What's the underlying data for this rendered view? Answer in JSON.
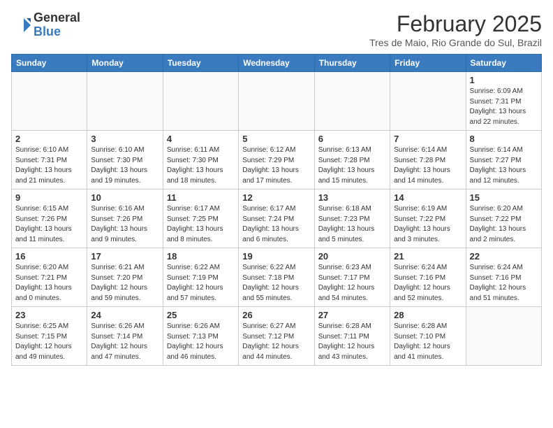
{
  "header": {
    "logo_general": "General",
    "logo_blue": "Blue",
    "month_title": "February 2025",
    "location": "Tres de Maio, Rio Grande do Sul, Brazil"
  },
  "weekdays": [
    "Sunday",
    "Monday",
    "Tuesday",
    "Wednesday",
    "Thursday",
    "Friday",
    "Saturday"
  ],
  "weeks": [
    [
      {
        "day": "",
        "info": ""
      },
      {
        "day": "",
        "info": ""
      },
      {
        "day": "",
        "info": ""
      },
      {
        "day": "",
        "info": ""
      },
      {
        "day": "",
        "info": ""
      },
      {
        "day": "",
        "info": ""
      },
      {
        "day": "1",
        "info": "Sunrise: 6:09 AM\nSunset: 7:31 PM\nDaylight: 13 hours\nand 22 minutes."
      }
    ],
    [
      {
        "day": "2",
        "info": "Sunrise: 6:10 AM\nSunset: 7:31 PM\nDaylight: 13 hours\nand 21 minutes."
      },
      {
        "day": "3",
        "info": "Sunrise: 6:10 AM\nSunset: 7:30 PM\nDaylight: 13 hours\nand 19 minutes."
      },
      {
        "day": "4",
        "info": "Sunrise: 6:11 AM\nSunset: 7:30 PM\nDaylight: 13 hours\nand 18 minutes."
      },
      {
        "day": "5",
        "info": "Sunrise: 6:12 AM\nSunset: 7:29 PM\nDaylight: 13 hours\nand 17 minutes."
      },
      {
        "day": "6",
        "info": "Sunrise: 6:13 AM\nSunset: 7:28 PM\nDaylight: 13 hours\nand 15 minutes."
      },
      {
        "day": "7",
        "info": "Sunrise: 6:14 AM\nSunset: 7:28 PM\nDaylight: 13 hours\nand 14 minutes."
      },
      {
        "day": "8",
        "info": "Sunrise: 6:14 AM\nSunset: 7:27 PM\nDaylight: 13 hours\nand 12 minutes."
      }
    ],
    [
      {
        "day": "9",
        "info": "Sunrise: 6:15 AM\nSunset: 7:26 PM\nDaylight: 13 hours\nand 11 minutes."
      },
      {
        "day": "10",
        "info": "Sunrise: 6:16 AM\nSunset: 7:26 PM\nDaylight: 13 hours\nand 9 minutes."
      },
      {
        "day": "11",
        "info": "Sunrise: 6:17 AM\nSunset: 7:25 PM\nDaylight: 13 hours\nand 8 minutes."
      },
      {
        "day": "12",
        "info": "Sunrise: 6:17 AM\nSunset: 7:24 PM\nDaylight: 13 hours\nand 6 minutes."
      },
      {
        "day": "13",
        "info": "Sunrise: 6:18 AM\nSunset: 7:23 PM\nDaylight: 13 hours\nand 5 minutes."
      },
      {
        "day": "14",
        "info": "Sunrise: 6:19 AM\nSunset: 7:22 PM\nDaylight: 13 hours\nand 3 minutes."
      },
      {
        "day": "15",
        "info": "Sunrise: 6:20 AM\nSunset: 7:22 PM\nDaylight: 13 hours\nand 2 minutes."
      }
    ],
    [
      {
        "day": "16",
        "info": "Sunrise: 6:20 AM\nSunset: 7:21 PM\nDaylight: 13 hours\nand 0 minutes."
      },
      {
        "day": "17",
        "info": "Sunrise: 6:21 AM\nSunset: 7:20 PM\nDaylight: 12 hours\nand 59 minutes."
      },
      {
        "day": "18",
        "info": "Sunrise: 6:22 AM\nSunset: 7:19 PM\nDaylight: 12 hours\nand 57 minutes."
      },
      {
        "day": "19",
        "info": "Sunrise: 6:22 AM\nSunset: 7:18 PM\nDaylight: 12 hours\nand 55 minutes."
      },
      {
        "day": "20",
        "info": "Sunrise: 6:23 AM\nSunset: 7:17 PM\nDaylight: 12 hours\nand 54 minutes."
      },
      {
        "day": "21",
        "info": "Sunrise: 6:24 AM\nSunset: 7:16 PM\nDaylight: 12 hours\nand 52 minutes."
      },
      {
        "day": "22",
        "info": "Sunrise: 6:24 AM\nSunset: 7:16 PM\nDaylight: 12 hours\nand 51 minutes."
      }
    ],
    [
      {
        "day": "23",
        "info": "Sunrise: 6:25 AM\nSunset: 7:15 PM\nDaylight: 12 hours\nand 49 minutes."
      },
      {
        "day": "24",
        "info": "Sunrise: 6:26 AM\nSunset: 7:14 PM\nDaylight: 12 hours\nand 47 minutes."
      },
      {
        "day": "25",
        "info": "Sunrise: 6:26 AM\nSunset: 7:13 PM\nDaylight: 12 hours\nand 46 minutes."
      },
      {
        "day": "26",
        "info": "Sunrise: 6:27 AM\nSunset: 7:12 PM\nDaylight: 12 hours\nand 44 minutes."
      },
      {
        "day": "27",
        "info": "Sunrise: 6:28 AM\nSunset: 7:11 PM\nDaylight: 12 hours\nand 43 minutes."
      },
      {
        "day": "28",
        "info": "Sunrise: 6:28 AM\nSunset: 7:10 PM\nDaylight: 12 hours\nand 41 minutes."
      },
      {
        "day": "",
        "info": ""
      }
    ]
  ]
}
